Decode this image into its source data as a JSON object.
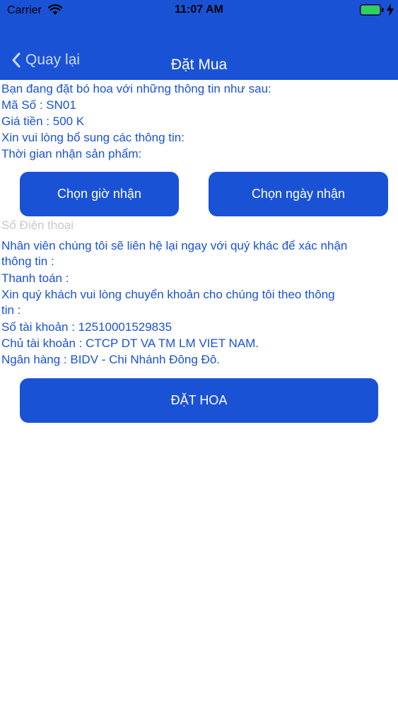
{
  "status_bar": {
    "carrier": "Carrier",
    "time": "11:07 AM"
  },
  "nav": {
    "back_label": "Quay lại",
    "title": "Đặt Mua"
  },
  "info": {
    "intro": "Bạn đang đặt bó hoa với những thông tin như sau:",
    "code": "Mã Số : SN01",
    "price": "Giá tiền : 500 K",
    "supplement": "Xin vui lòng bổ sung các thông tin:",
    "receive_time": "Thời gian nhận sản phẩm:"
  },
  "buttons": {
    "choose_time": "Chọn giờ nhận",
    "choose_date": "Chọn ngày nhận",
    "order": "ĐẶT HOA"
  },
  "phone": {
    "placeholder": "Số Điện thoại",
    "value": ""
  },
  "details": {
    "contact_line1": "Nhân viên chúng tôi sẽ liên hệ lại ngay với quý khác để xác nhận",
    "contact_line2": "thông tin :",
    "payment": "Thanh toán :",
    "transfer_line1": "Xin quý khách vui lòng chuyển khoản cho chúng tôi theo thông",
    "transfer_line2": "tin :",
    "account_number": "Số tài khoản : 12510001529835",
    "account_owner": "Chủ tài khoản : CTCP DT VA TM LM VIET NAM.",
    "bank": "Ngân hàng  : BIDV - Chi Nhánh Đông Đô."
  },
  "colors": {
    "primary": "#1a52d6",
    "placeholder": "#c8c8cc",
    "battery": "#2fd158"
  }
}
